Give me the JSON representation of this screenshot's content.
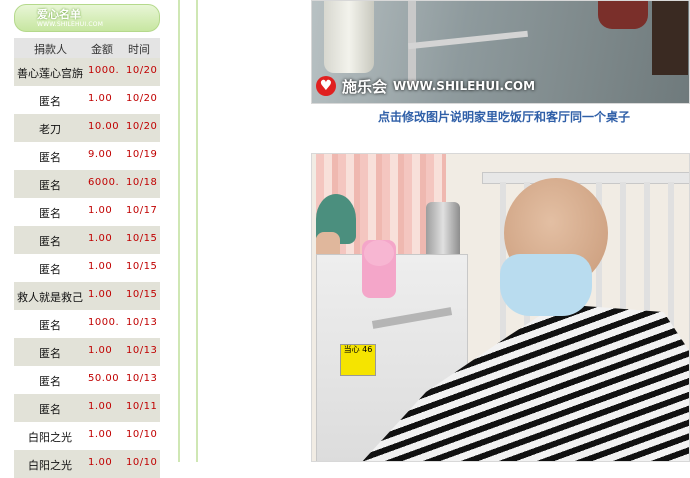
{
  "sidebar": {
    "title": "爱心名单",
    "subtitle": "WWW.SHILEHUI.COM",
    "columns": [
      "捐款人",
      "金额",
      "时间"
    ],
    "rows": [
      {
        "name": "善心莲心宫旃",
        "amount": "1000.",
        "time": "10/20"
      },
      {
        "name": "匿名",
        "amount": "1.00",
        "time": "10/20"
      },
      {
        "name": "老刀",
        "amount": "10.00",
        "time": "10/20"
      },
      {
        "name": "匿名",
        "amount": "9.00",
        "time": "10/19"
      },
      {
        "name": "匿名",
        "amount": "6000.",
        "time": "10/18"
      },
      {
        "name": "匿名",
        "amount": "1.00",
        "time": "10/17"
      },
      {
        "name": "匿名",
        "amount": "1.00",
        "time": "10/15"
      },
      {
        "name": "匿名",
        "amount": "1.00",
        "time": "10/15"
      },
      {
        "name": "救人就是救己",
        "amount": "1.00",
        "time": "10/15"
      },
      {
        "name": "匿名",
        "amount": "1000.",
        "time": "10/13"
      },
      {
        "name": "匿名",
        "amount": "1.00",
        "time": "10/13"
      },
      {
        "name": "匿名",
        "amount": "50.00",
        "time": "10/13"
      },
      {
        "name": "匿名",
        "amount": "1.00",
        "time": "10/11"
      },
      {
        "name": "白阳之光",
        "amount": "1.00",
        "time": "10/10"
      },
      {
        "name": "白阳之光",
        "amount": "1.00",
        "time": "10/10"
      }
    ]
  },
  "main": {
    "logo": {
      "brand": "施乐会",
      "url": "WWW.SHILEHUI.COM"
    },
    "caption": "点击修改图片说明家里吃饭厅和客厅同一个桌子",
    "sticker_text": "当心 46"
  },
  "colors": {
    "accent_green": "#c7e6a1",
    "amount_red": "#c00000",
    "caption_blue": "#2f5fa8",
    "row_shade": "#e2e2d8"
  }
}
